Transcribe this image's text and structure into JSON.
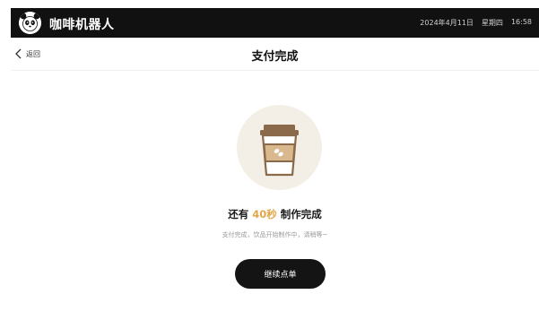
{
  "header": {
    "app_title": "咖啡机器人",
    "date": "2024年4月11日",
    "weekday": "星期四",
    "time": "16:58",
    "logo_icon": "panda-logo-icon"
  },
  "nav": {
    "back_label": "返回",
    "back_icon": "chevron-left-icon",
    "title": "支付完成"
  },
  "status": {
    "prefix": "还有",
    "countdown": "40秒",
    "suffix": "制作完成",
    "subtext": "支付完成，饮品开始制作中，请稍等~",
    "illustration_icon": "coffee-cup-icon"
  },
  "actions": {
    "continue_label": "继续点单"
  },
  "colors": {
    "header_bg": "#111111",
    "accent": "#e0a84a",
    "cup_brown": "#8a6a4b",
    "cup_sleeve": "#d9b88e",
    "circle_bg": "#f4efe6",
    "button_bg": "#141414"
  }
}
